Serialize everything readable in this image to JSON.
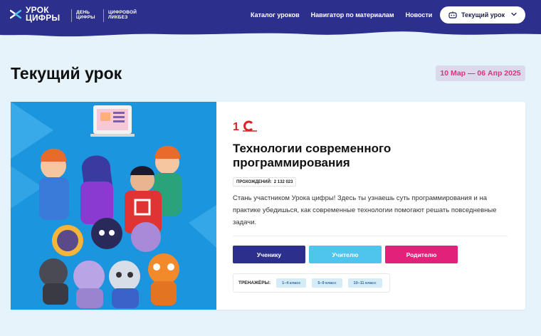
{
  "header": {
    "logo_line1": "УРОК",
    "logo_line2": "ЦИФРЫ",
    "sub1_line1": "ДЕНЬ",
    "sub1_line2": "ЦИФРЫ",
    "sub2_line1": "ЦИФРОВОЙ",
    "sub2_line2": "ЛИКБЕЗ",
    "nav": [
      "Каталог уроков",
      "Навигатор по материалам",
      "Новости"
    ],
    "current_button": "Текущий урок",
    "bg_color": "#2c2f8c"
  },
  "page": {
    "title": "Текущий урок",
    "date_range": "10 Мар — 06 Апр 2025"
  },
  "lesson": {
    "brand": "1С",
    "title": "Технологии современного программирования",
    "passes_label": "ПРОХОЖДЕНИЙ:",
    "passes_value": "2 132 023",
    "description": "Стань участником Урока цифры! Здесь ты узнаешь суть программирования и на практике убедишься, как современные технологии помогают решать повседневные задачи.",
    "buttons": {
      "student": "Ученику",
      "teacher": "Учителю",
      "parent": "Родителю"
    },
    "trainers_label": "ТРЕНАЖЁРЫ:",
    "trainer_grades": [
      "1–4 класс",
      "5–9 класс",
      "10–11 класс"
    ]
  },
  "colors": {
    "brand_dark": "#2c2f8c",
    "accent_pink": "#e2217a",
    "accent_light_blue": "#4fc4ec",
    "image_bg": "#1b95dd"
  }
}
